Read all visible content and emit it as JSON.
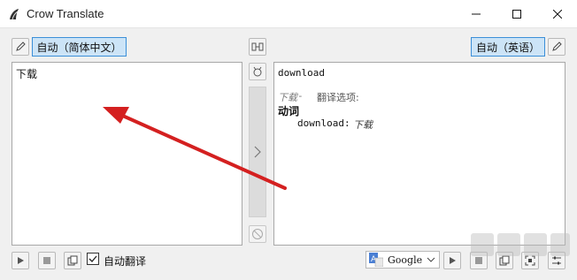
{
  "window": {
    "title": "Crow Translate"
  },
  "toolbar": {
    "source_language": "自动（简体中文）",
    "target_language": "自动（英语）"
  },
  "source": {
    "text": "下载"
  },
  "result": {
    "word": "download",
    "options_word": "下载",
    "options_separator": " - ",
    "options_label": "翻译选项:",
    "pos": "动词",
    "entry_term": "download:",
    "entry_translation": "下载"
  },
  "bottom": {
    "auto_translate_label": "自动翻译",
    "auto_translate_checked": true,
    "engine": "Google"
  },
  "colors": {
    "accent": "#cce4f7",
    "accent_border": "#3b8fd8",
    "arrow": "#d42020"
  }
}
